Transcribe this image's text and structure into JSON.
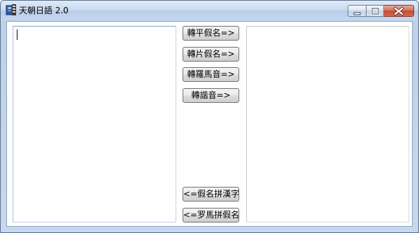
{
  "window": {
    "title": "天朝日語 2.0"
  },
  "editor": {
    "input_value": "",
    "output_value": ""
  },
  "buttons": {
    "to_hiragana": "轉平假名=>",
    "to_katakana": "轉片假名=>",
    "to_romaji": "轉羅馬音=>",
    "to_homophone": "轉諧音=>",
    "kana_to_kanji": "<=假名拼漢字",
    "romaji_to_kana": "<=罗馬拼假名"
  },
  "icons": {
    "app": "app-icon",
    "minimize": "minimize-icon",
    "maximize": "maximize-icon",
    "close": "close-icon"
  },
  "colors": {
    "titlebar": "#c8d9ee",
    "close_button": "#c74a32",
    "button_face": "#ebebeb"
  }
}
